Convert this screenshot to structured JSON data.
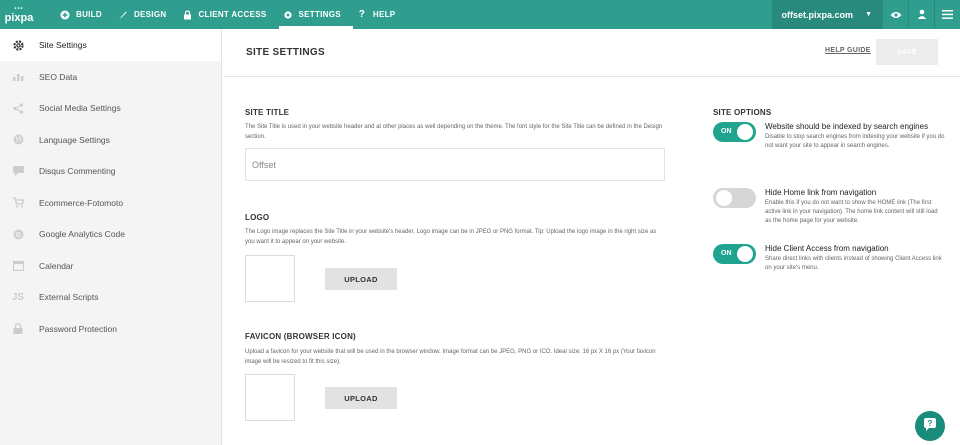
{
  "app": {
    "logo": "pixpa"
  },
  "nav": {
    "items": [
      {
        "label": "BUILD",
        "icon": "plus-circle-icon"
      },
      {
        "label": "DESIGN",
        "icon": "brush-icon"
      },
      {
        "label": "CLIENT ACCESS",
        "icon": "lock-icon"
      },
      {
        "label": "SETTINGS",
        "icon": "gear-icon",
        "active": true
      },
      {
        "label": "HELP",
        "icon": "question-icon"
      }
    ],
    "domain": "offset.pixpa.com"
  },
  "sidebar": {
    "items": [
      {
        "label": "Site Settings",
        "icon": "gear-icon"
      },
      {
        "label": "SEO Data",
        "icon": "bar-chart-icon"
      },
      {
        "label": "Social Media Settings",
        "icon": "share-icon"
      },
      {
        "label": "Language Settings",
        "icon": "globe-icon"
      },
      {
        "label": "Disqus Commenting",
        "icon": "comment-icon"
      },
      {
        "label": "Ecommerce-Fotomoto",
        "icon": "cart-icon"
      },
      {
        "label": "Google Analytics Code",
        "icon": "google-icon"
      },
      {
        "label": "Calendar",
        "icon": "calendar-icon"
      },
      {
        "label": "External Scripts",
        "icon": "js-icon"
      },
      {
        "label": "Password Protection",
        "icon": "lock-icon"
      }
    ]
  },
  "header": {
    "title": "SITE SETTINGS",
    "help_guide": "HELP GUIDE",
    "save": "SAVE"
  },
  "site_title": {
    "heading": "SITE TITLE",
    "description": "The Site Title is used in your website header and at other places as well depending on the theme. The font style for the Site Title can be defined in the Design section.",
    "value": "Offset"
  },
  "logo": {
    "heading": "LOGO",
    "description": "The Logo image replaces the Site Title in your website's header. Logo image can be in JPEG or PNG format. Tip: Upload the logo image in the right size as you want it to appear on your website.",
    "upload": "UPLOAD"
  },
  "favicon": {
    "heading": "FAVICON (BROWSER ICON)",
    "description": "Upload a favicon for your website that will be used in the browser window. Image format can be JPEG, PNG or ICO. Ideal size: 16 px X 16 px (Your favicon image will be resized to fit this size).",
    "upload": "UPLOAD"
  },
  "site_options": {
    "heading": "SITE OPTIONS",
    "on_label": "ON",
    "options": [
      {
        "title": "Website should be indexed by search engines",
        "description": "Disable to stop search engines from indexing your website if you do not want your site to appear in search engines.",
        "on": true
      },
      {
        "title": "Hide Home link from navigation",
        "description": "Enable this if you do not want to show the HOME link (The first active link in your navigation). The home link content will still load as the home page for your website.",
        "on": false
      },
      {
        "title": "Hide Client Access from navigation",
        "description": "Share direct links with clients instead of showing Client Access link on your site's menu.",
        "on": true
      }
    ]
  },
  "colors": {
    "brand": "#2f9e8f",
    "toggle_on": "#1fa58f"
  }
}
